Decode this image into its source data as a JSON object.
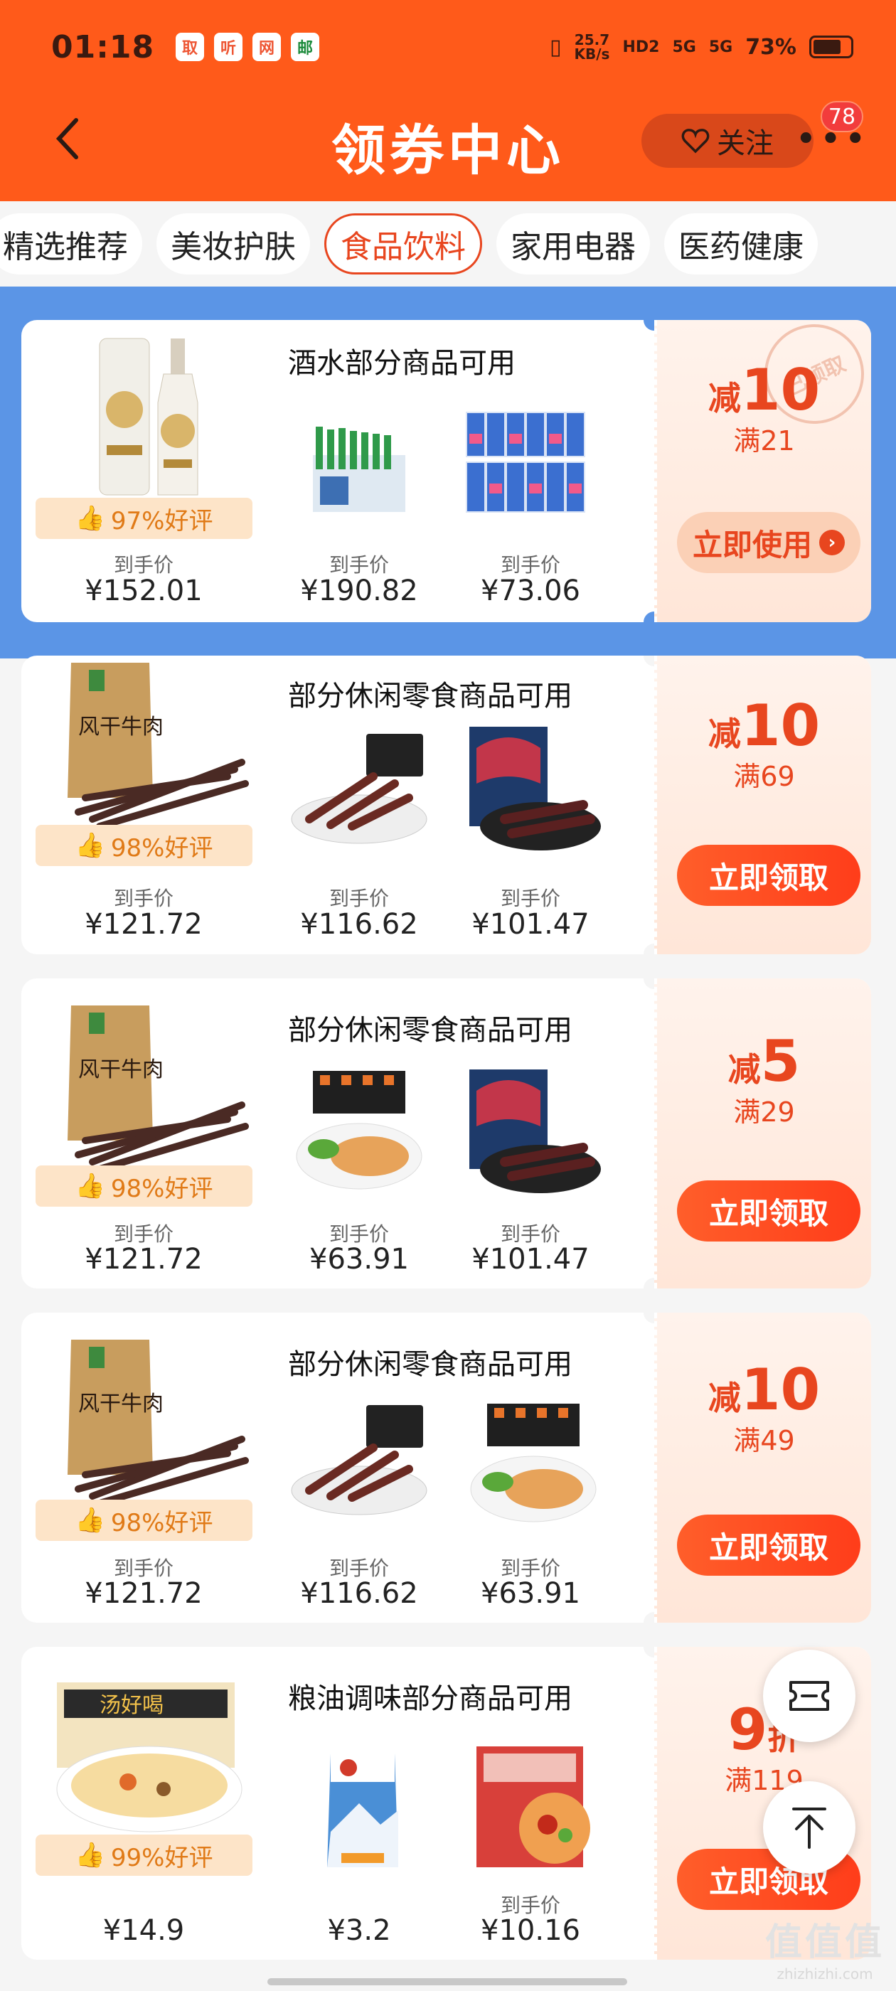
{
  "status": {
    "time": "01:18",
    "netspeed": "25.7",
    "netunit": "KB/s",
    "hd": "HD2",
    "sig1": "5G",
    "sig2": "5G",
    "battery": "73%",
    "app_icons": [
      "取",
      "听",
      "网",
      "邮"
    ]
  },
  "header": {
    "title": "领券中心",
    "follow_label": "关注",
    "more": "•••",
    "badge": "78"
  },
  "tabs": [
    {
      "label": "精选推荐",
      "active": false
    },
    {
      "label": "美妆护肤",
      "active": false
    },
    {
      "label": "食品饮料",
      "active": true
    },
    {
      "label": "家用电器",
      "active": false
    },
    {
      "label": "医药健康",
      "active": false
    }
  ],
  "coupons": [
    {
      "condition": "酒水部分商品可用",
      "rating": "97%好评",
      "deal_prefix": "减",
      "deal_amount": "10",
      "threshold": "满21",
      "button": "立即使用",
      "stamp": "已领取",
      "products": [
        {
          "label": "到手价",
          "price": "¥152.01",
          "icon": "vodka-bottle-icon"
        },
        {
          "label": "到手价",
          "price": "¥190.82",
          "icon": "soju-crate-icon"
        },
        {
          "label": "到手价",
          "price": "¥73.06",
          "icon": "beer-cans-icon"
        }
      ]
    },
    {
      "condition": "部分休闲零食商品可用",
      "rating": "98%好评",
      "deal_prefix": "减",
      "deal_amount": "10",
      "threshold": "满69",
      "button": "立即领取",
      "products": [
        {
          "label": "到手价",
          "price": "¥121.72",
          "icon": "beef-jerky-bag-icon"
        },
        {
          "label": "到手价",
          "price": "¥116.62",
          "icon": "beef-jerky-plate-icon"
        },
        {
          "label": "到手价",
          "price": "¥101.47",
          "icon": "jerky-package-icon"
        }
      ]
    },
    {
      "condition": "部分休闲零食商品可用",
      "rating": "98%好评",
      "deal_prefix": "减",
      "deal_amount": "5",
      "threshold": "满29",
      "button": "立即领取",
      "products": [
        {
          "label": "到手价",
          "price": "¥121.72",
          "icon": "beef-jerky-bag-icon"
        },
        {
          "label": "到手价",
          "price": "¥63.91",
          "icon": "chicken-breast-icon"
        },
        {
          "label": "到手价",
          "price": "¥101.47",
          "icon": "jerky-package-icon"
        }
      ]
    },
    {
      "condition": "部分休闲零食商品可用",
      "rating": "98%好评",
      "deal_prefix": "减",
      "deal_amount": "10",
      "threshold": "满49",
      "button": "立即领取",
      "products": [
        {
          "label": "到手价",
          "price": "¥121.72",
          "icon": "beef-jerky-bag-icon"
        },
        {
          "label": "到手价",
          "price": "¥116.62",
          "icon": "beef-jerky-plate-icon"
        },
        {
          "label": "到手价",
          "price": "¥63.91",
          "icon": "chicken-breast-icon"
        }
      ]
    },
    {
      "condition": "粮油调味部分商品可用",
      "rating": "99%好评",
      "deal_prefix": "",
      "deal_amount": "9",
      "deal_suffix": "折",
      "threshold": "满119",
      "button": "立即领取",
      "products": [
        {
          "label": "",
          "price": "¥14.9",
          "icon": "noodle-bowl-icon"
        },
        {
          "label": "",
          "price": "¥3.2",
          "icon": "salt-pouch-icon"
        },
        {
          "label": "到手价",
          "price": "¥10.16",
          "icon": "rice-noodle-bag-icon"
        }
      ]
    }
  ],
  "watermark": {
    "big": "值值值",
    "small": "zhizhizhi.com"
  }
}
